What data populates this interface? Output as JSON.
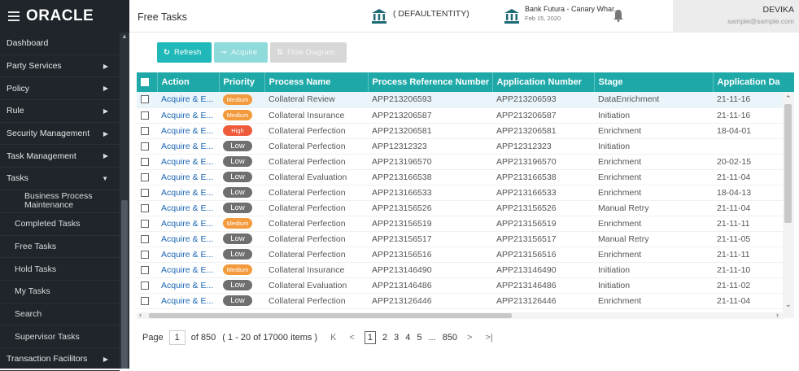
{
  "brand": {
    "logo_text": "ORACLE",
    "menu_icon": "hamburger-icon"
  },
  "sidebar": {
    "items": [
      {
        "label": "Dashboard",
        "arrow": ""
      },
      {
        "label": "Party Services",
        "arrow": "▶"
      },
      {
        "label": "Policy",
        "arrow": "▶"
      },
      {
        "label": "Rule",
        "arrow": "▶"
      },
      {
        "label": "Security Management",
        "arrow": "▶"
      },
      {
        "label": "Task Management",
        "arrow": "▶"
      },
      {
        "label": "Tasks",
        "arrow": "▼"
      }
    ],
    "sub_items": [
      "Business Process Maintenance",
      "Completed Tasks",
      "Free Tasks",
      "Hold Tasks",
      "My Tasks",
      "Search",
      "Supervisor Tasks"
    ],
    "footer_item": {
      "label": "Transaction Facilitors",
      "arrow": "▶"
    }
  },
  "header": {
    "title": "Free Tasks",
    "entity": "( DEFAULTENTITY)",
    "bank_name": "Bank Futura - Canary Whar...",
    "bank_date": "Feb 15, 2020",
    "user_name": "DEVIKA",
    "user_email": "sample@sample.com"
  },
  "toolbar": {
    "refresh_label": "Refresh",
    "acquire_label": "Acquire",
    "flow_label": "Flow Diagram"
  },
  "table": {
    "columns": [
      "Action",
      "Priority",
      "Process Name",
      "Process Reference Number",
      "Application Number",
      "Stage",
      "Application Da"
    ],
    "rows": [
      [
        "Acquire & E...",
        "Medium",
        "Collateral Review",
        "APP213206593",
        "APP213206593",
        "DataEnrichment",
        "21-11-16"
      ],
      [
        "Acquire & E...",
        "Medium",
        "Collateral Insurance",
        "APP213206587",
        "APP213206587",
        "Initiation",
        "21-11-16"
      ],
      [
        "Acquire & E...",
        "High",
        "Collateral Perfection",
        "APP213206581",
        "APP213206581",
        "Enrichment",
        "18-04-01"
      ],
      [
        "Acquire & E...",
        "Low",
        "Collateral Perfection",
        "APP12312323",
        "APP12312323",
        "Initiation",
        ""
      ],
      [
        "Acquire & E...",
        "Low",
        "Collateral Perfection",
        "APP213196570",
        "APP213196570",
        "Enrichment",
        "20-02-15"
      ],
      [
        "Acquire & E...",
        "Low",
        "Collateral Evaluation",
        "APP213166538",
        "APP213166538",
        "Enrichment",
        "21-11-04"
      ],
      [
        "Acquire & E...",
        "Low",
        "Collateral Perfection",
        "APP213166533",
        "APP213166533",
        "Enrichment",
        "18-04-13"
      ],
      [
        "Acquire & E...",
        "Low",
        "Collateral Perfection",
        "APP213156526",
        "APP213156526",
        "Manual Retry",
        "21-11-04"
      ],
      [
        "Acquire & E...",
        "Medium",
        "Collateral Perfection",
        "APP213156519",
        "APP213156519",
        "Enrichment",
        "21-11-11"
      ],
      [
        "Acquire & E...",
        "Low",
        "Collateral Perfection",
        "APP213156517",
        "APP213156517",
        "Manual Retry",
        "21-11-05"
      ],
      [
        "Acquire & E...",
        "Low",
        "Collateral Perfection",
        "APP213156516",
        "APP213156516",
        "Enrichment",
        "21-11-11"
      ],
      [
        "Acquire & E...",
        "Medium",
        "Collateral Insurance",
        "APP213146490",
        "APP213146490",
        "Initiation",
        "21-11-10"
      ],
      [
        "Acquire & E...",
        "Low",
        "Collateral Evaluation",
        "APP213146486",
        "APP213146486",
        "Initiation",
        "21-11-02"
      ],
      [
        "Acquire & E...",
        "Low",
        "Collateral Perfection",
        "APP213126446",
        "APP213126446",
        "Enrichment",
        "21-11-04"
      ]
    ]
  },
  "pager": {
    "page_label": "Page",
    "current_page": "1",
    "of_text": "of 850",
    "items_text": "( 1 - 20 of 17000 items )",
    "first_icon": "first-page-icon",
    "prev_icon": "prev-page-icon",
    "pages": [
      "1",
      "2",
      "3",
      "4",
      "5",
      "...",
      "850"
    ],
    "next_icon": "next-page-icon",
    "last_icon": "last-page-icon"
  },
  "colors": {
    "sidebar_bg": "#1f252b",
    "header_teal": "#1ea8a8",
    "priority_medium": "#f39a3c",
    "priority_high": "#ef5a3a",
    "priority_low": "#6f6f6f",
    "link": "#1b66b3"
  }
}
